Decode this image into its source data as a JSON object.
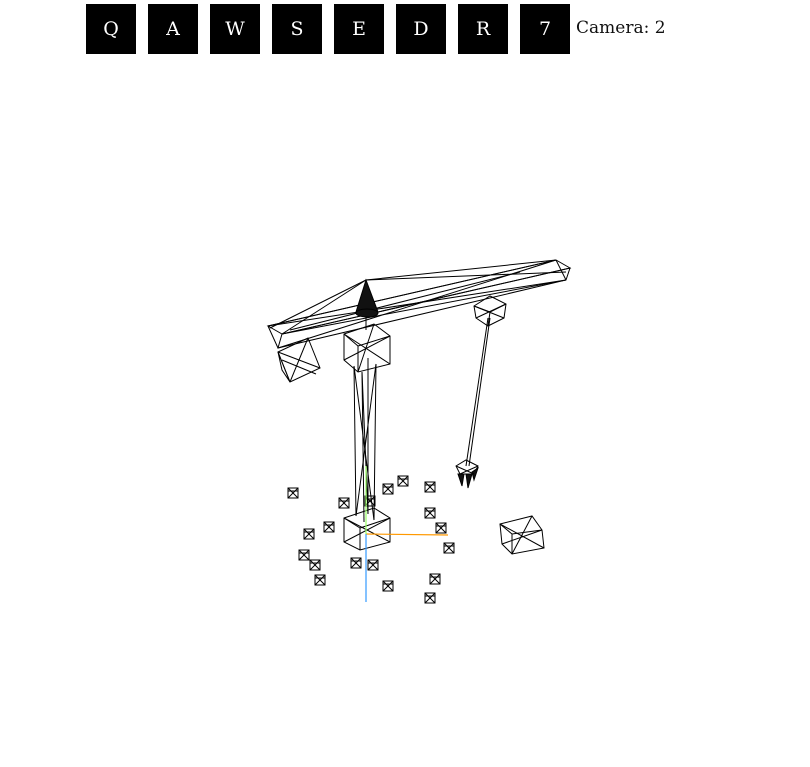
{
  "toolbar": {
    "buttons": [
      {
        "label": "Q",
        "name": "key-q-button"
      },
      {
        "label": "A",
        "name": "key-a-button"
      },
      {
        "label": "W",
        "name": "key-w-button"
      },
      {
        "label": "S",
        "name": "key-s-button"
      },
      {
        "label": "E",
        "name": "key-e-button"
      },
      {
        "label": "D",
        "name": "key-d-button"
      },
      {
        "label": "R",
        "name": "key-r-button"
      },
      {
        "label": "7",
        "name": "key-7-button"
      }
    ]
  },
  "camera": {
    "readout": "Camera: 2"
  },
  "colors": {
    "button_bg": "#000000",
    "button_text": "#ffffff",
    "wireframe": "#000000",
    "axis_x": "#ff9900",
    "axis_y": "#99ff66",
    "axis_z": "#3399ff"
  }
}
